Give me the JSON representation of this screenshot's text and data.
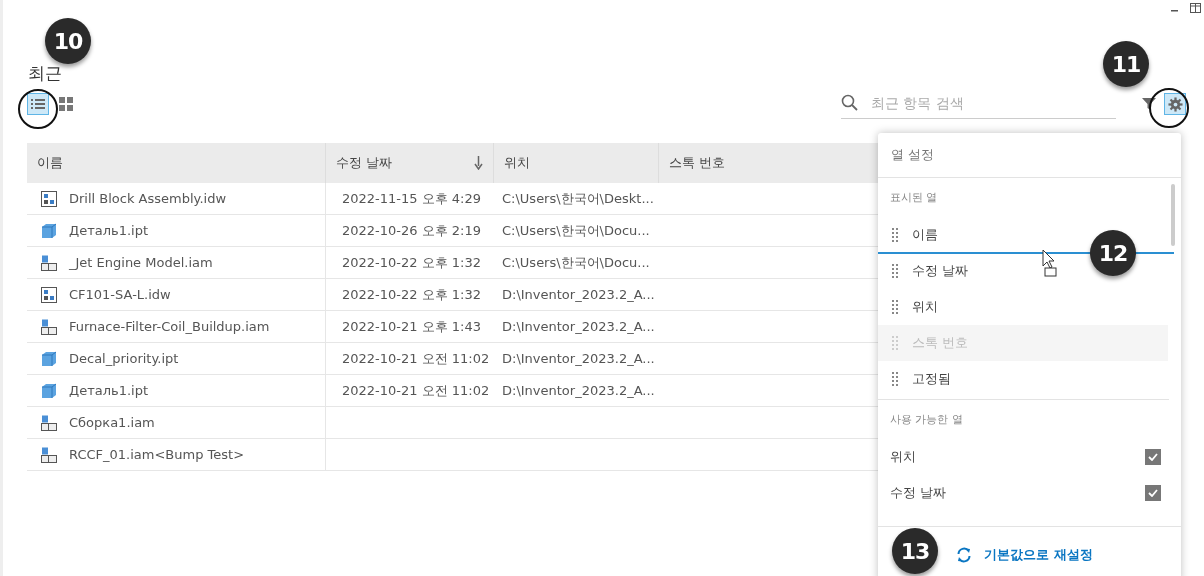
{
  "title": "최근",
  "view_modes": [
    {
      "kind": "list",
      "selected": true
    },
    {
      "kind": "grid",
      "selected": false
    }
  ],
  "search": {
    "placeholder": "최근 항목 검색"
  },
  "settings_button": {
    "selected": true
  },
  "table": {
    "columns": [
      {
        "label": "이름",
        "sorted": false
      },
      {
        "label": "수정 날짜",
        "sorted": true
      },
      {
        "label": "위치",
        "sorted": false
      },
      {
        "label": "스톡 번호",
        "sorted": false
      }
    ],
    "rows": [
      {
        "kind": "drawing",
        "name": "Drill Block Assembly.idw",
        "modified": "2022-11-15 오후 4:29",
        "location": "C:\\Users\\한국어\\Deskt..."
      },
      {
        "kind": "part",
        "name": "Деталь1.ipt",
        "modified": "2022-10-26 오후 2:19",
        "location": "C:\\Users\\한국어\\Docu..."
      },
      {
        "kind": "assembly",
        "name": "_Jet Engine Model.iam",
        "modified": "2022-10-22 오후 1:32",
        "location": "C:\\Users\\한국어\\Docu..."
      },
      {
        "kind": "drawing",
        "name": "CF101-SA-L.idw",
        "modified": "2022-10-22 오후 1:32",
        "location": "D:\\Inventor_2023.2_A..."
      },
      {
        "kind": "assembly",
        "name": "Furnace-Filter-Coil_Buildup.iam",
        "modified": "2022-10-21 오후 1:43",
        "location": "D:\\Inventor_2023.2_A..."
      },
      {
        "kind": "part",
        "name": "Decal_priority.ipt",
        "modified": "2022-10-21 오전 11:02",
        "location": "D:\\Inventor_2023.2_A..."
      },
      {
        "kind": "part",
        "name": "Деталь1.ipt",
        "modified": "2022-10-21 오전 11:02",
        "location": "D:\\Inventor_2023.2_A..."
      },
      {
        "kind": "assembly",
        "name": "Сборка1.iam"
      },
      {
        "kind": "assembly",
        "name": "RCCF_01.iam<Bump Test>"
      }
    ]
  },
  "column_settings": {
    "title": "열 설정",
    "shown_heading": "표시된 열",
    "shown": [
      {
        "label": "이름",
        "disabled": false
      },
      {
        "label": "수정 날짜",
        "disabled": false
      },
      {
        "label": "위치",
        "disabled": false
      },
      {
        "label": "스톡 번호",
        "disabled": true
      },
      {
        "label": "고정됨",
        "disabled": false
      }
    ],
    "available_heading": "사용 가능한 열",
    "available": [
      {
        "label": "위치",
        "checked": true
      },
      {
        "label": "수정 날짜",
        "checked": true
      }
    ],
    "reset": "기본값으로 재설정"
  },
  "callouts": [
    "10",
    "11",
    "12",
    "13"
  ]
}
